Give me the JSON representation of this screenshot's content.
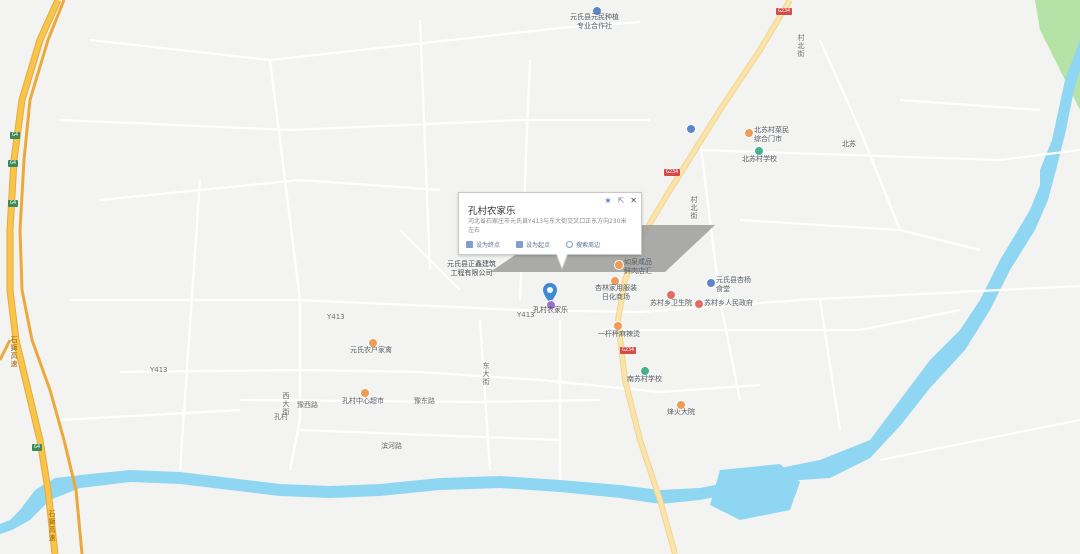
{
  "popup": {
    "title": "孔村农家乐",
    "address": "河北省石家庄市元氏县Y413与东大街交叉口正东方向230米左右",
    "actions": [
      {
        "label": "设为终点"
      },
      {
        "label": "设为起点"
      },
      {
        "label": "搜索周边"
      }
    ]
  },
  "selected_place": "孔村农家乐",
  "pois": [
    {
      "name_line1": "元氏县元民种植",
      "name_line2": "专业合作社"
    },
    {
      "name_line1": "北苏村菜民",
      "name_line2": "综合门市"
    },
    {
      "name_line1": "北苏村学校",
      "name_line2": ""
    },
    {
      "name_line1": "北苏",
      "name_line2": ""
    },
    {
      "name_line1": "元氏县正鑫建筑",
      "name_line2": "工程有限公司"
    },
    {
      "name_line1": "如泉咸品",
      "name_line2": "鲜肉店汇"
    },
    {
      "name_line1": "杏林家用服装",
      "name_line2": "日化商场"
    },
    {
      "name_line1": "元氏县杏杨",
      "name_line2": "食堂"
    },
    {
      "name_line1": "苏村乡卫生院",
      "name_line2": ""
    },
    {
      "name_line1": "苏村乡人民政府",
      "name_line2": ""
    },
    {
      "name_line1": "一杆秤麻辣烫",
      "name_line2": ""
    },
    {
      "name_line1": "元氏农户家禽",
      "name_line2": ""
    },
    {
      "name_line1": "南苏村学校",
      "name_line2": ""
    },
    {
      "name_line1": "孔村中心超市",
      "name_line2": ""
    },
    {
      "name_line1": "烽火大院",
      "name_line2": ""
    }
  ],
  "roads": {
    "y413_a": "Y413",
    "y413_b": "Y413",
    "y413_c": "Y413",
    "g234_a": "G234",
    "g234_b": "G234",
    "g234_c": "G234",
    "g234_d": "G234",
    "cunbei": "村北街",
    "cunbei2": "村北街",
    "dongdajie": "东大街",
    "xidajie": "西大街",
    "yuxi": "豫西路",
    "yudong": "豫东路",
    "binhe": "滨河路",
    "kongcun": "孔村",
    "shishi": "石獅高速",
    "shishi2": "石獅高速",
    "g4_a": "G4",
    "g4_b": "G4",
    "g4_c": "G4",
    "g4_d": "G4"
  },
  "colors": {
    "background": "#f3f3f1",
    "water": "#8fd6f2",
    "highway": "#f6c54a",
    "national_road": "#f7dd96",
    "local_road": "#ffffff",
    "park": "#b5e2a6"
  }
}
